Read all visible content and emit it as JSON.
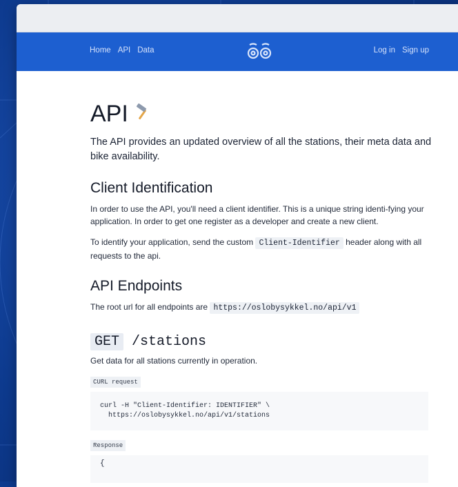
{
  "nav": {
    "links_left": [
      "Home",
      "API",
      "Data"
    ],
    "links_right": [
      "Log in",
      "Sign up"
    ],
    "logo_icon": "bike-logo-icon"
  },
  "page": {
    "title": "API",
    "title_icon": "hammer-icon",
    "lead": "The API provides an updated overview of all the stations, their meta data and bike availability."
  },
  "client_identification": {
    "heading": "Client Identification",
    "para1": "In order to use the API, you'll need a client identifier. This is a unique string identi-fying your application. In order to get one register as a developer and create a new client.",
    "para2_before": "To identify your application, send the custom ",
    "para2_code": "Client-Identifier",
    "para2_after": " header along with all requests to the api."
  },
  "api_endpoints": {
    "heading": "API Endpoints",
    "root_before": "The root url for all endpoints are ",
    "root_url": "https://oslobysykkel.no/api/v1"
  },
  "stations_endpoint": {
    "method": "GET",
    "path": "/stations",
    "description": "Get data for all stations currently in operation.",
    "curl_label": "CURL request",
    "curl_line1": "curl -H \"Client-Identifier: IDENTIFIER\" \\",
    "curl_line2": "  https://oslobysykkel.no/api/v1/stations",
    "response_label": "Response",
    "response_start": "{"
  },
  "colors": {
    "nav_blue": "#1d5fd0",
    "page_bg_blue": "#0e3b8f"
  }
}
